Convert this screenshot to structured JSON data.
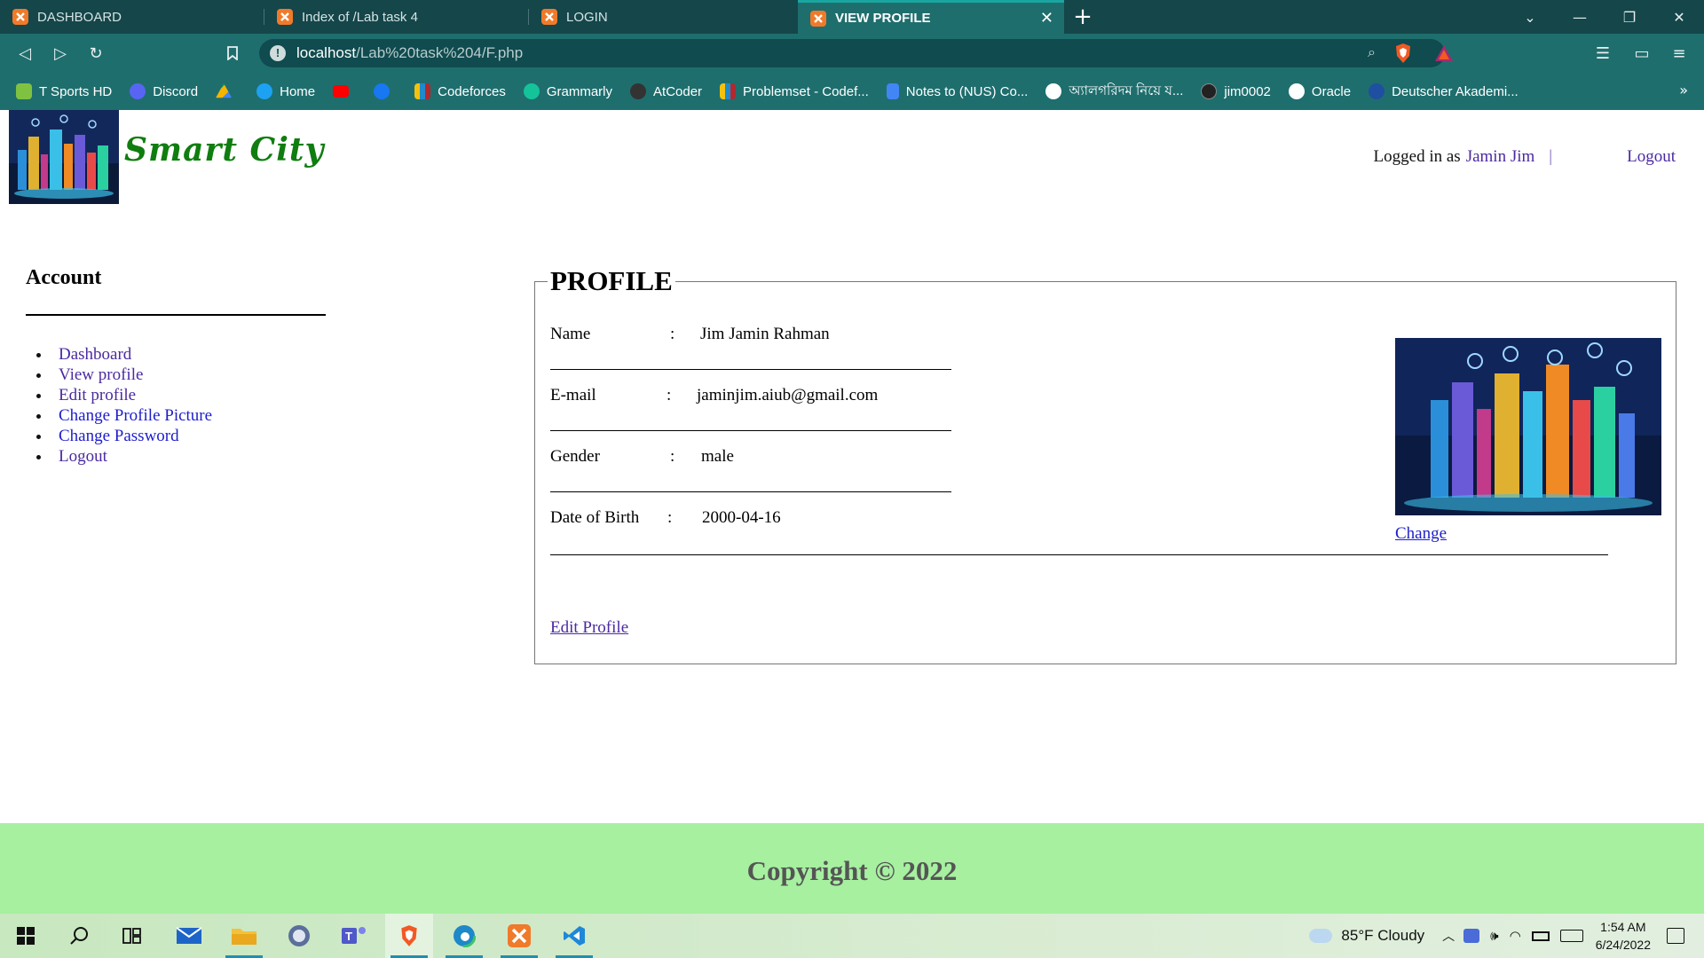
{
  "browser": {
    "tabs": [
      {
        "title": "DASHBOARD",
        "active": false
      },
      {
        "title": "Index of /Lab task 4",
        "active": false
      },
      {
        "title": "LOGIN",
        "active": false
      },
      {
        "title": "VIEW PROFILE",
        "active": true
      }
    ],
    "url_host": "localhost",
    "url_path": "/Lab%20task%204/F.php",
    "bookmarks": [
      {
        "label": "T Sports HD",
        "icon": "tsports-icon",
        "color": "#7fc241"
      },
      {
        "label": "Discord",
        "icon": "discord-icon",
        "color": "#5865f2"
      },
      {
        "label": "",
        "icon": "google-drive-icon",
        "color": "#f4b400"
      },
      {
        "label": "Home",
        "icon": "twitter-icon",
        "color": "#1da1f2"
      },
      {
        "label": "",
        "icon": "youtube-icon",
        "color": "#ff0000"
      },
      {
        "label": "",
        "icon": "facebook-icon",
        "color": "#1877f2"
      },
      {
        "label": "Codeforces",
        "icon": "codeforces-icon",
        "color": "#f4c20d"
      },
      {
        "label": "Grammarly",
        "icon": "grammarly-icon",
        "color": "#15c39a"
      },
      {
        "label": "AtCoder",
        "icon": "atcoder-icon",
        "color": "#333333"
      },
      {
        "label": "Problemset - Codef...",
        "icon": "codeforces-icon",
        "color": "#f4c20d"
      },
      {
        "label": "Notes to (NUS) Co...",
        "icon": "docs-icon",
        "color": "#4285f4"
      },
      {
        "label": "অ্যালগরিদম নিয়ে য...",
        "icon": "globe-icon",
        "color": "#ffffff"
      },
      {
        "label": "jim0002",
        "icon": "github-icon",
        "color": "#222222"
      },
      {
        "label": "Oracle",
        "icon": "globe-icon",
        "color": "#ffffff"
      },
      {
        "label": "Deutscher Akademi...",
        "icon": "daad-icon",
        "color": "#1f4fa0"
      }
    ],
    "more": "»"
  },
  "site": {
    "brand": "Smart City",
    "logged_in_prefix": "Logged in as",
    "user": "Jamin Jim",
    "pipe": "|",
    "logout": "Logout"
  },
  "sidebar": {
    "title": "Account",
    "items": [
      {
        "label": "Dashboard"
      },
      {
        "label": "View profile"
      },
      {
        "label": "Edit profile"
      },
      {
        "label": "Change Profile Picture"
      },
      {
        "label": "Change Password"
      },
      {
        "label": "Logout"
      }
    ]
  },
  "profile": {
    "legend": "PROFILE",
    "fields": [
      {
        "label": "Name",
        "colon": ":",
        "value": "Jim Jamin Rahman"
      },
      {
        "label": "E-mail",
        "colon": ":",
        "value": "jaminjim.aiub@gmail.com"
      },
      {
        "label": "Gender",
        "colon": ":",
        "value": "male"
      },
      {
        "label": "Date of Birth",
        "colon": ":",
        "value": "2000-04-16"
      }
    ],
    "edit_link": "Edit Profile",
    "change_link": "Change"
  },
  "footer": {
    "text": "Copyright © 2022"
  },
  "taskbar": {
    "weather": "85°F  Cloudy",
    "time": "1:54 AM",
    "date": "6/24/2022"
  },
  "colors": {
    "chrome_dark": "#14464a",
    "chrome": "#1f6e6e",
    "brand_green": "#0f7d0f",
    "link_purple": "#4b2aa0",
    "link_blue": "#1d1dcc",
    "footer_bg": "#a6f0a0"
  }
}
